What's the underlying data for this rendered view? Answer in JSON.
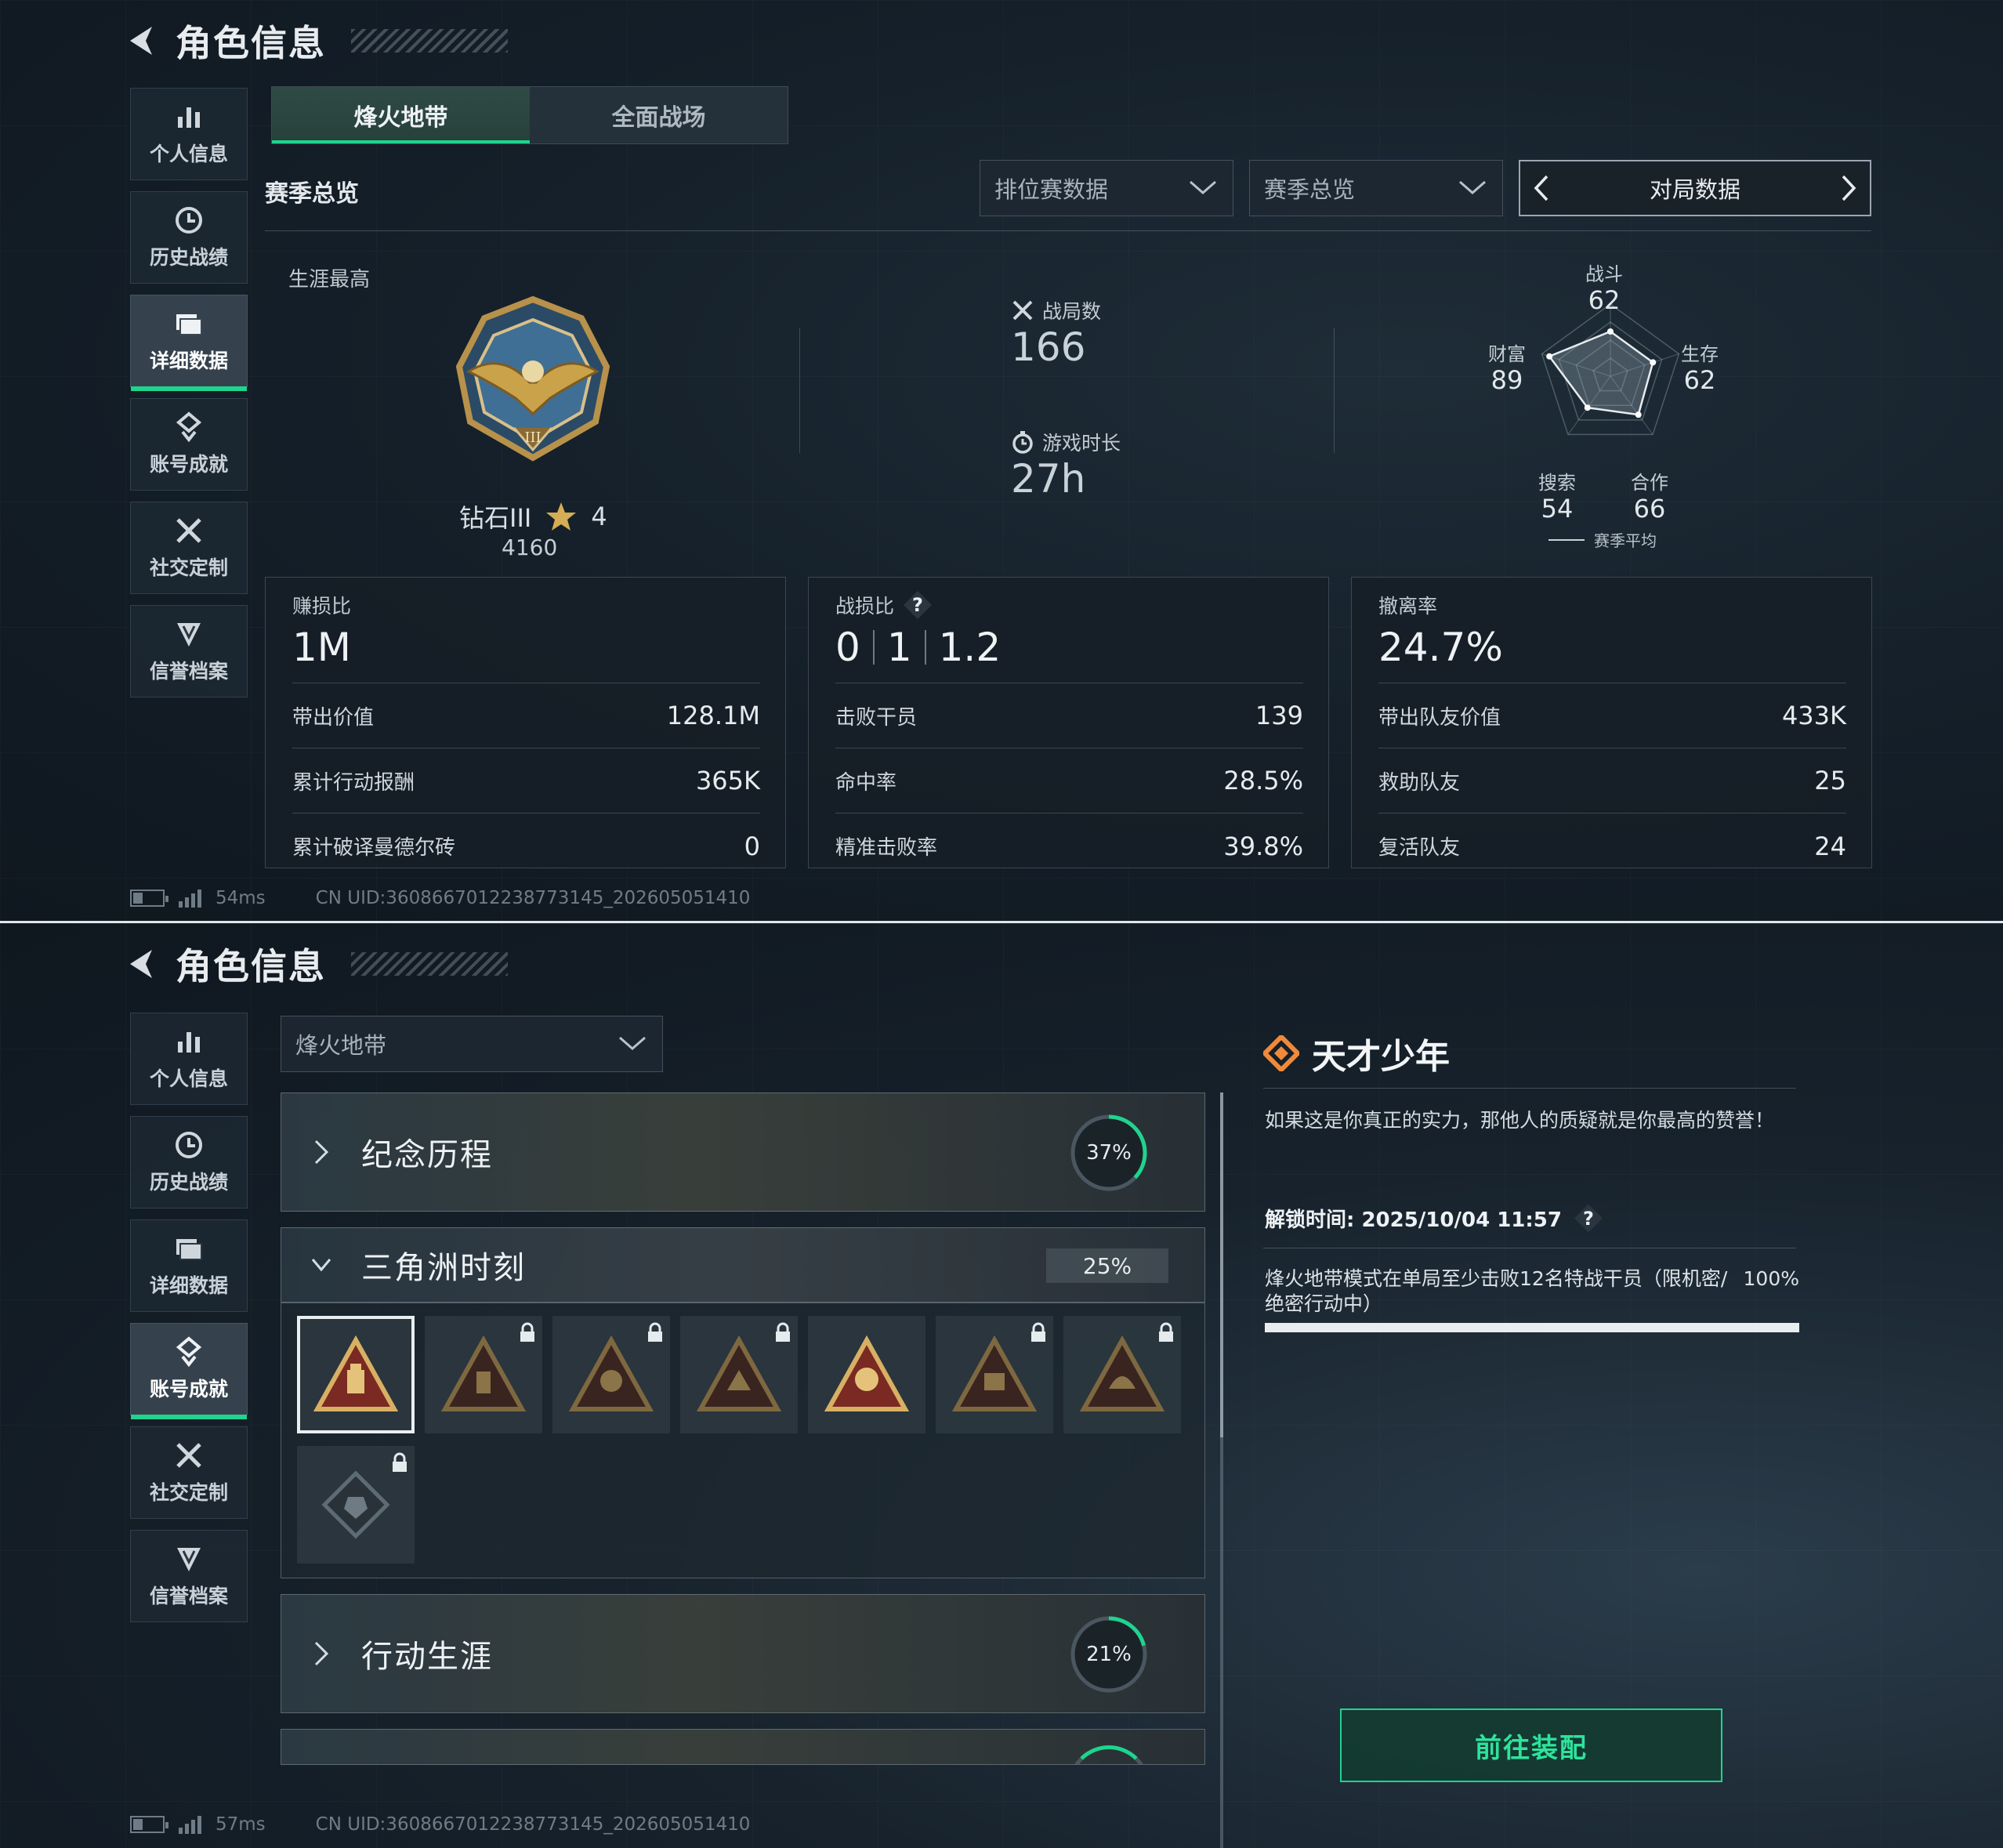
{
  "page_title": "角色信息",
  "sidebar": {
    "items": [
      {
        "label": "个人信息",
        "icon": "bar-chart-icon"
      },
      {
        "label": "历史战绩",
        "icon": "clock-icon"
      },
      {
        "label": "详细数据",
        "icon": "folder-icon"
      },
      {
        "label": "账号成就",
        "icon": "medal-icon"
      },
      {
        "label": "社交定制",
        "icon": "crossed-tools-icon"
      },
      {
        "label": "信誉档案",
        "icon": "shield-icon"
      }
    ],
    "active_screen1": 2,
    "active_screen2": 3
  },
  "screen1": {
    "tabs": [
      {
        "label": "烽火地带",
        "active": true
      },
      {
        "label": "全面战场",
        "active": false
      }
    ],
    "section_title": "赛季总览",
    "filters": {
      "dropdown1": "排位赛数据",
      "dropdown2": "赛季总览",
      "pager_label": "对局数据"
    },
    "career": {
      "label": "生涯最高",
      "rank_name": "钻石III",
      "stars": "4",
      "score": "4160"
    },
    "stats": {
      "matches_label": "战局数",
      "matches_value": "166",
      "playtime_label": "游戏时长",
      "playtime_value": "27h"
    },
    "radar": {
      "axes": [
        {
          "label": "战斗",
          "value": "62"
        },
        {
          "label": "生存",
          "value": "62"
        },
        {
          "label": "合作",
          "value": "66"
        },
        {
          "label": "搜索",
          "value": "54"
        },
        {
          "label": "财富",
          "value": "89"
        }
      ],
      "legend": "赛季平均",
      "values_numeric": [
        62,
        62,
        66,
        54,
        89
      ]
    },
    "cards": [
      {
        "label": "赚损比",
        "value": "1M",
        "rows": [
          {
            "k": "带出价值",
            "v": "128.1M"
          },
          {
            "k": "累计行动报酬",
            "v": "365K"
          },
          {
            "k": "累计破译曼德尔砖",
            "v": "0"
          }
        ]
      },
      {
        "label": "战损比",
        "kd": [
          "0",
          "1",
          "1.2"
        ],
        "help": "?",
        "rows": [
          {
            "k": "击败干员",
            "v": "139"
          },
          {
            "k": "命中率",
            "v": "28.5%"
          },
          {
            "k": "精准击败率",
            "v": "39.8%"
          }
        ]
      },
      {
        "label": "撤离率",
        "value": "24.7%",
        "rows": [
          {
            "k": "带出队友价值",
            "v": "433K"
          },
          {
            "k": "救助队友",
            "v": "25"
          },
          {
            "k": "复活队友",
            "v": "24"
          }
        ]
      }
    ],
    "footer": {
      "ping": "54ms",
      "uid": "CN UID:3608667012238773145_202605051410"
    }
  },
  "screen2": {
    "mode_dropdown": "烽火地带",
    "categories": [
      {
        "name": "纪念历程",
        "percent": "37%",
        "progress": 0.37
      },
      {
        "name": "三角洲时刻",
        "percent": "25%",
        "progress": 0.25
      },
      {
        "name": "行动生涯",
        "percent": "21%",
        "progress": 0.21
      }
    ],
    "achievement": {
      "title": "天才少年",
      "description": "如果这是你真正的实力，那他人的质疑就是你最高的赞誉！",
      "unlock_label": "解锁时间: 2025/10/04 11:57",
      "help": "?",
      "condition": "烽火地带模式在单局至少击败12名特战干员（限机密/绝密行动中）",
      "condition_progress": "100%",
      "button": "前往装配"
    },
    "footer": {
      "ping": "57ms",
      "uid": "CN UID:3608667012238773145_202605051410"
    }
  },
  "colors": {
    "accent": "#1fd48e",
    "orange": "#f08a3a",
    "gold": "#c9a24a"
  }
}
